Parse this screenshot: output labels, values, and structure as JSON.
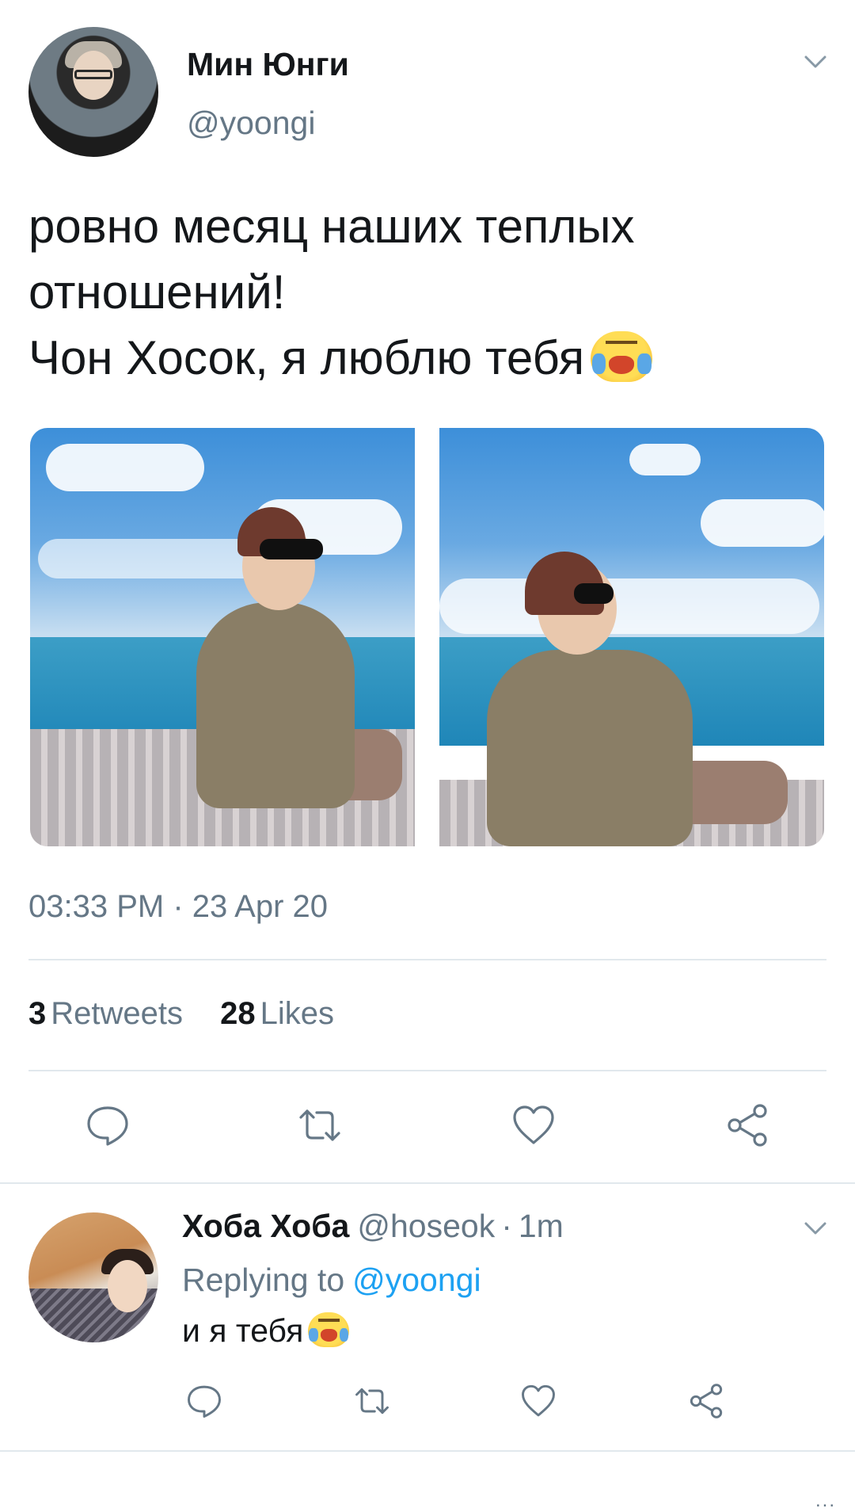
{
  "tweet": {
    "author": {
      "display_name": "Мин Юнги",
      "handle": "@yoongi"
    },
    "text_lines": [
      "ровно месяц наших теплых",
      "отношений!",
      "Чон Хосок, я люблю тебя"
    ],
    "text_emoji": "loudly-crying-face",
    "timestamp": "03:33 PM · 23 Apr 20",
    "stats": {
      "retweets_count": "3",
      "retweets_label": "Retweets",
      "likes_count": "28",
      "likes_label": "Likes"
    },
    "actions": [
      "reply-icon",
      "retweet-icon",
      "like-icon",
      "share-icon"
    ]
  },
  "reply": {
    "author": {
      "display_name": "Хоба Хоба",
      "handle": "@hoseok"
    },
    "separator": "·",
    "time": "1m",
    "replying_to_label": "Replying to",
    "replying_to_handle": "@yoongi",
    "text": "и я тебя",
    "text_emoji": "loudly-crying-face",
    "actions": [
      "reply-icon",
      "retweet-icon",
      "like-icon",
      "share-icon"
    ]
  },
  "footer": {
    "more": "..."
  },
  "colors": {
    "text": "#14171a",
    "secondary": "#657786",
    "accent": "#1da1f2",
    "divider": "#e1e8ed"
  }
}
